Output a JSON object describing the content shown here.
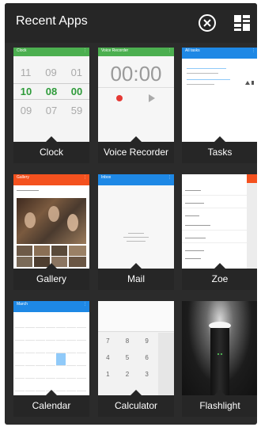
{
  "header": {
    "title": "Recent Apps",
    "close_all_icon": "close-circle-icon",
    "layout_icon": "grid-layout-icon"
  },
  "apps": [
    {
      "label": "Clock",
      "thumb": {
        "bar_color": "#4caf50",
        "bar_title": "Clock",
        "rows": [
          [
            "11",
            "09",
            "01"
          ],
          [
            "10",
            "08",
            "00"
          ],
          [
            "09",
            "07",
            "59"
          ]
        ]
      }
    },
    {
      "label": "Voice Recorder",
      "thumb": {
        "bar_color": "#4caf50",
        "bar_title": "Voice Recorder",
        "time": "00:00"
      }
    },
    {
      "label": "Tasks",
      "thumb": {
        "bar_color": "#1e88e5",
        "bar_title": "All tasks"
      }
    },
    {
      "label": "Gallery",
      "thumb": {
        "bar_color": "#f4511e",
        "bar_title": "Gallery"
      }
    },
    {
      "label": "Mail",
      "thumb": {
        "bar_color": "#1e88e5",
        "bar_title": "Inbox"
      }
    },
    {
      "label": "Zoe",
      "thumb": {
        "bar_color": "#f4511e"
      }
    },
    {
      "label": "Calendar",
      "thumb": {
        "bar_color": "#1e88e5",
        "bar_title": "March"
      }
    },
    {
      "label": "Calculator",
      "thumb": {
        "keys": [
          [
            "7",
            "8",
            "9"
          ],
          [
            "4",
            "5",
            "6"
          ],
          [
            "1",
            "2",
            "3"
          ]
        ]
      }
    },
    {
      "label": "Flashlight",
      "thumb": {}
    }
  ]
}
